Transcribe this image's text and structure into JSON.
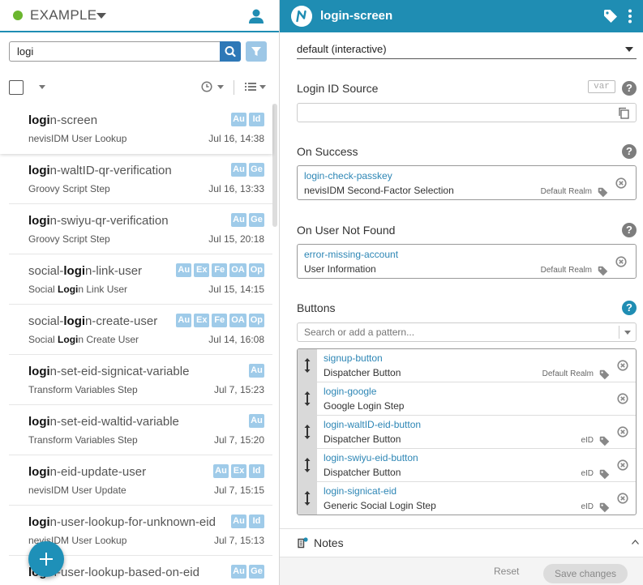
{
  "project": {
    "name": "EXAMPLE",
    "status_color": "#6bb62e"
  },
  "icons": {
    "user": "user-icon",
    "search": "search-icon",
    "filter": "filter-icon",
    "clock": "clock-icon",
    "list": "list-icon",
    "add": "plus-icon",
    "tag": "tag-icon",
    "menu": "kebab-icon",
    "copy": "copy-icon",
    "remove": "remove-circle-icon",
    "drag": "drag-handle-icon",
    "notes": "notes-icon"
  },
  "search": {
    "value": "logi"
  },
  "nodes": [
    {
      "highlight": "logi",
      "rest": "n-screen",
      "type_pre": "",
      "type_hl": "",
      "type_rest": "nevisIDM User Lookup",
      "time": "Jul 16, 14:38",
      "badges": [
        "Au",
        "Id"
      ]
    },
    {
      "highlight": "logi",
      "rest": "n-waltID-qr-verification",
      "type_pre": "",
      "type_hl": "",
      "type_rest": "Groovy Script Step",
      "time": "Jul 16, 13:33",
      "badges": [
        "Au",
        "Ge"
      ]
    },
    {
      "highlight": "logi",
      "rest": "n-swiyu-qr-verification",
      "type_pre": "",
      "type_hl": "",
      "type_rest": "Groovy Script Step",
      "time": "Jul 15, 20:18",
      "badges": [
        "Au",
        "Ge"
      ]
    },
    {
      "pre": "social-",
      "highlight": "logi",
      "rest": "n-link-user",
      "type_pre": "Social ",
      "type_hl": "Logi",
      "type_rest": "n Link User",
      "time": "Jul 15, 14:15",
      "badges": [
        "Au",
        "Ex",
        "Fe",
        "OA",
        "Op"
      ]
    },
    {
      "pre": "social-",
      "highlight": "logi",
      "rest": "n-create-user",
      "type_pre": "Social ",
      "type_hl": "Logi",
      "type_rest": "n Create User",
      "time": "Jul 14, 16:08",
      "badges": [
        "Au",
        "Ex",
        "Fe",
        "OA",
        "Op"
      ]
    },
    {
      "highlight": "logi",
      "rest": "n-set-eid-signicat-variable",
      "type_pre": "",
      "type_hl": "",
      "type_rest": "Transform Variables Step",
      "time": "Jul 7, 15:23",
      "badges": [
        "Au"
      ]
    },
    {
      "highlight": "logi",
      "rest": "n-set-eid-waltid-variable",
      "type_pre": "",
      "type_hl": "",
      "type_rest": "Transform Variables Step",
      "time": "Jul 7, 15:20",
      "badges": [
        "Au"
      ]
    },
    {
      "highlight": "logi",
      "rest": "n-eid-update-user",
      "type_pre": "",
      "type_hl": "",
      "type_rest": "nevisIDM User Update",
      "time": "Jul 7, 15:15",
      "badges": [
        "Au",
        "Ex",
        "Id"
      ]
    },
    {
      "highlight": "logi",
      "rest": "n-user-lookup-for-unknown-eid",
      "type_pre": "",
      "type_hl": "",
      "type_rest": "nevisIDM User Lookup",
      "time": "Jul 7, 15:13",
      "badges": [
        "Au",
        "Id"
      ]
    },
    {
      "highlight": "logi",
      "rest": "n-user-lookup-based-on-eid",
      "type_pre": "",
      "type_hl": "",
      "type_rest": "",
      "time": "",
      "badges": [
        "Au",
        "Ge"
      ]
    }
  ],
  "editor": {
    "title": "login-screen",
    "mode": "default (interactive)",
    "login_id_source": {
      "label": "Login ID Source",
      "var": "var",
      "value": ""
    },
    "on_success": {
      "label": "On Success",
      "name": "login-check-passkey",
      "type": "nevisIDM Second-Factor Selection",
      "realm": "Default Realm"
    },
    "on_user_not_found": {
      "label": "On User Not Found",
      "name": "error-missing-account",
      "type": "User Information",
      "realm": "Default Realm"
    },
    "buttons": {
      "label": "Buttons",
      "placeholder": "Search or add a pattern...",
      "items": [
        {
          "name": "signup-button",
          "type": "Dispatcher Button",
          "realm": "Default Realm"
        },
        {
          "name": "login-google",
          "type": "Google Login Step",
          "realm": ""
        },
        {
          "name": "login-waltID-eid-button",
          "type": "Dispatcher Button",
          "realm": "eID"
        },
        {
          "name": "login-swiyu-eid-button",
          "type": "Dispatcher Button",
          "realm": "eID"
        },
        {
          "name": "login-signicat-eid",
          "type": "Generic Social Login Step",
          "realm": "eID"
        }
      ]
    },
    "help": "?",
    "notes_label": "Notes",
    "reset_label": "Reset",
    "save_label": "Save changes"
  },
  "colors": {
    "accent": "#1f8db3",
    "badge": "#9fcbe9",
    "link": "#2d86b5"
  }
}
